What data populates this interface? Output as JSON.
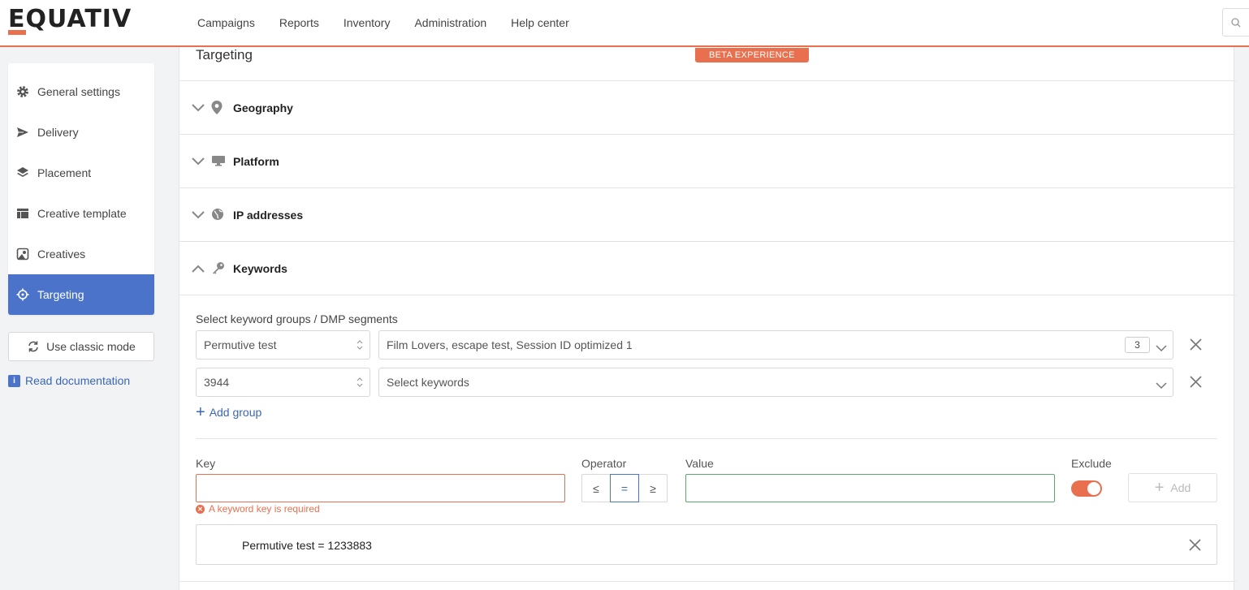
{
  "header": {
    "logo": "EQUATIV",
    "nav": [
      "Campaigns",
      "Reports",
      "Inventory",
      "Administration",
      "Help center"
    ]
  },
  "sidebar": {
    "items": [
      {
        "label": "General settings",
        "icon": "gear-icon"
      },
      {
        "label": "Delivery",
        "icon": "send-icon"
      },
      {
        "label": "Placement",
        "icon": "layers-icon"
      },
      {
        "label": "Creative template",
        "icon": "layout-icon"
      },
      {
        "label": "Creatives",
        "icon": "image-icon"
      },
      {
        "label": "Targeting",
        "icon": "crosshair-icon",
        "active": true
      }
    ],
    "classic_mode": "Use classic mode",
    "documentation": "Read documentation"
  },
  "main": {
    "title": "Targeting",
    "beta_badge": "BETA EXPERIENCE",
    "sections": [
      {
        "label": "Geography",
        "icon": "map-pin-icon",
        "expanded": false
      },
      {
        "label": "Platform",
        "icon": "monitor-icon",
        "expanded": false
      },
      {
        "label": "IP addresses",
        "icon": "globe-icon",
        "expanded": false
      },
      {
        "label": "Keywords",
        "icon": "key-icon",
        "expanded": true
      }
    ],
    "keywords": {
      "groups_label": "Select keyword groups / DMP segments",
      "groups": [
        {
          "segment": "Permutive test",
          "keywords": "Film Lovers, escape test, Session ID optimized 1",
          "count": "3"
        },
        {
          "segment": "3944",
          "keywords": "Select keywords",
          "count": ""
        }
      ],
      "add_group": "Add group",
      "key_label": "Key",
      "key_value": "",
      "key_error": "A keyword key is required",
      "operator_label": "Operator",
      "operators": [
        "≤",
        "=",
        "≥"
      ],
      "selected_operator": "=",
      "value_label": "Value",
      "value_value": "",
      "exclude_label": "Exclude",
      "exclude_on": true,
      "add_button": "Add",
      "entries": [
        "Permutive test = 1233883"
      ]
    }
  },
  "colors": {
    "accent": "#e8704f",
    "primary": "#4a73c9",
    "link": "#3a66b8"
  }
}
